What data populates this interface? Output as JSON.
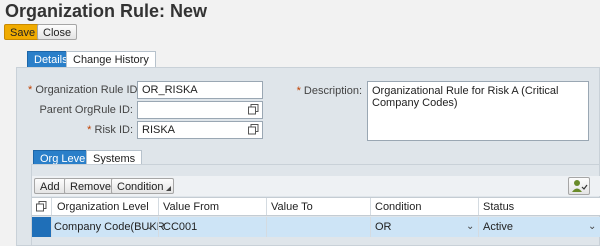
{
  "page": {
    "title": "Organization Rule: New"
  },
  "toolbar": {
    "save": "Save",
    "close": "Close"
  },
  "tabs": [
    {
      "label": "Details"
    },
    {
      "label": "Change History"
    }
  ],
  "form": {
    "rule_id_label": "Organization Rule ID:",
    "rule_id_value": "OR_RISKA",
    "parent_label": "Parent OrgRule ID:",
    "parent_value": "",
    "risk_label": "Risk ID:",
    "risk_value": "RISKA",
    "desc_label": "Description:",
    "desc_value": "Organizational Rule for Risk A (Critical Company Codes)",
    "required_marker": "*"
  },
  "subtabs": [
    {
      "label": "Org Level"
    },
    {
      "label": "Systems"
    }
  ],
  "grid_toolbar": {
    "add": "Add",
    "remove": "Remove",
    "condition": "Condition"
  },
  "grid": {
    "columns": [
      "Organization Level",
      "Value From",
      "Value To",
      "Condition",
      "Status"
    ],
    "rows": [
      {
        "org_level": "Company Code(BUKR",
        "value_from": "CC001",
        "value_to": "",
        "condition": "OR",
        "status": "Active"
      }
    ]
  },
  "icons": {
    "value_help": "value-help-icon",
    "settings": "personalize-icon",
    "select_all": "select-all-icon",
    "dropdown": "chevron-down-icon"
  },
  "colors": {
    "primary_button": "#f0ab00",
    "active_tab": "#2a7fc9",
    "selected_row": "#cde4f6"
  }
}
